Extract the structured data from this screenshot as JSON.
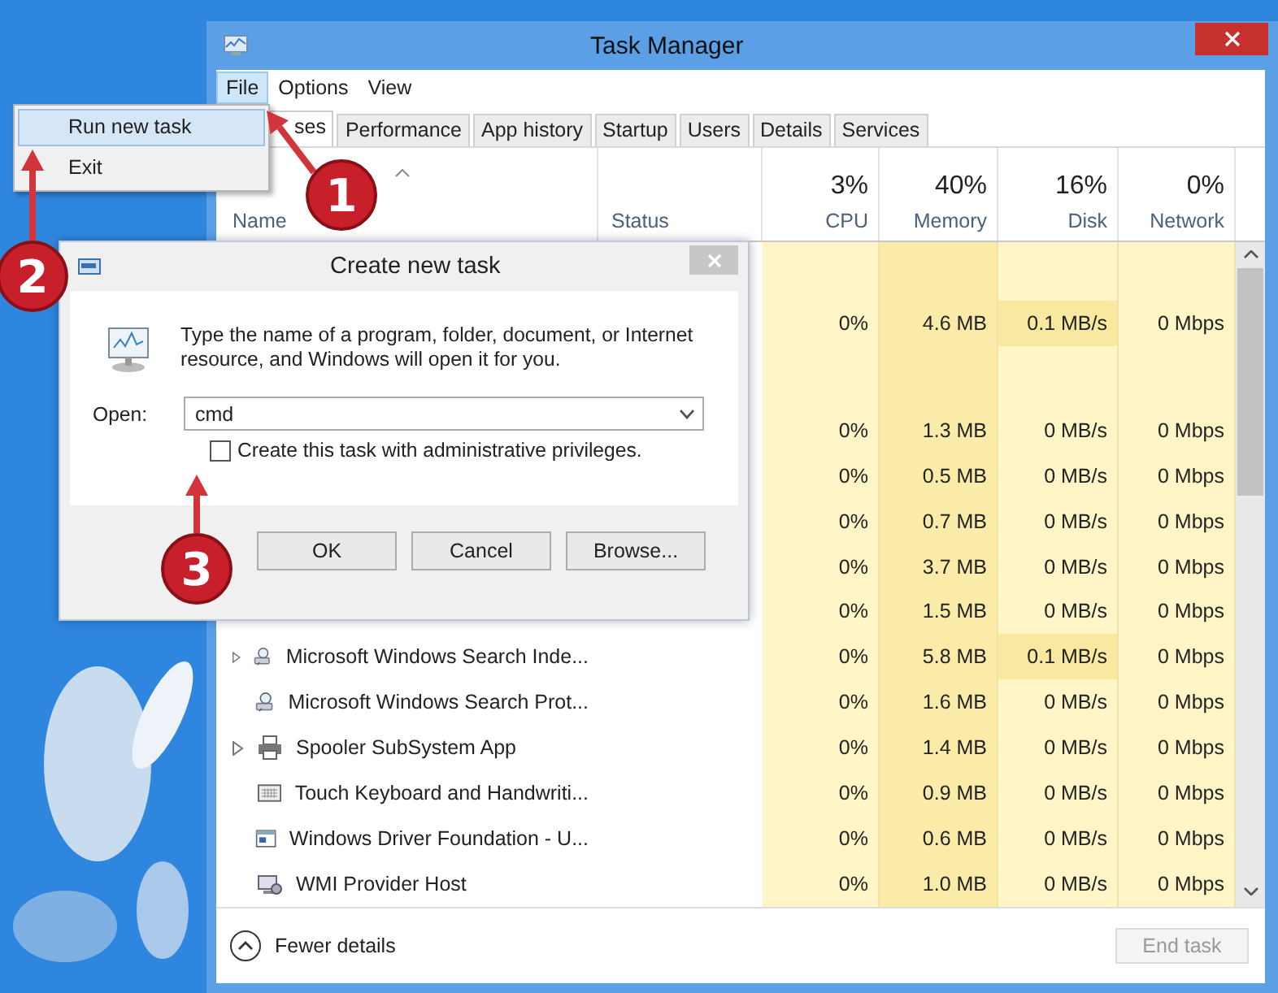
{
  "task_manager": {
    "title": "Task Manager",
    "menu": [
      {
        "label": "File",
        "selected": true
      },
      {
        "label": "Options",
        "selected": false
      },
      {
        "label": "View",
        "selected": false
      }
    ],
    "tabs": [
      {
        "label": "ses",
        "selected": true
      },
      {
        "label": "Performance",
        "selected": false
      },
      {
        "label": "App history",
        "selected": false
      },
      {
        "label": "Startup",
        "selected": false
      },
      {
        "label": "Users",
        "selected": false
      },
      {
        "label": "Details",
        "selected": false
      },
      {
        "label": "Services",
        "selected": false
      }
    ],
    "columns": [
      {
        "label": "Name"
      },
      {
        "label": "Status"
      },
      {
        "usage": "3%",
        "label": "CPU",
        "highlighted": false
      },
      {
        "usage": "40%",
        "label": "Memory",
        "highlighted": true
      },
      {
        "usage": "16%",
        "label": "Disk",
        "highlighted": false
      },
      {
        "usage": "0%",
        "label": "Network",
        "highlighted": false
      }
    ],
    "rows": [
      {
        "kind": "group"
      },
      {
        "kind": "hidden",
        "cells": [
          "0%",
          "4.6 MB",
          "0.1 MB/s",
          "0 Mbps"
        ],
        "disk_active": true
      },
      {
        "kind": "group"
      },
      {
        "kind": "hidden",
        "cells": [
          "0%",
          "1.3 MB",
          "0 MB/s",
          "0 Mbps"
        ],
        "disk_active": false
      },
      {
        "kind": "hidden",
        "cells": [
          "0%",
          "0.5 MB",
          "0 MB/s",
          "0 Mbps"
        ],
        "disk_active": false
      },
      {
        "kind": "hidden",
        "cells": [
          "0%",
          "0.7 MB",
          "0 MB/s",
          "0 Mbps"
        ],
        "disk_active": false
      },
      {
        "kind": "hidden",
        "cells": [
          "0%",
          "3.7 MB",
          "0 MB/s",
          "0 Mbps"
        ],
        "disk_active": false
      },
      {
        "kind": "hidden",
        "cells": [
          "0%",
          "1.5 MB",
          "0 MB/s",
          "0 Mbps"
        ],
        "disk_active": false
      },
      {
        "kind": "search",
        "name": "Microsoft Windows Search Inde...",
        "expandable": true,
        "cells": [
          "0%",
          "5.8 MB",
          "0.1 MB/s",
          "0 Mbps"
        ],
        "disk_active": true
      },
      {
        "kind": "search",
        "name": "Microsoft Windows Search Prot...",
        "expandable": false,
        "cells": [
          "0%",
          "1.6 MB",
          "0 MB/s",
          "0 Mbps"
        ],
        "disk_active": false
      },
      {
        "kind": "printer",
        "name": "Spooler SubSystem App",
        "expandable": true,
        "cells": [
          "0%",
          "1.4 MB",
          "0 MB/s",
          "0 Mbps"
        ],
        "disk_active": false
      },
      {
        "kind": "keyboard",
        "name": "Touch Keyboard and Handwriti...",
        "expandable": false,
        "cells": [
          "0%",
          "0.9 MB",
          "0 MB/s",
          "0 Mbps"
        ],
        "disk_active": false
      },
      {
        "kind": "driver",
        "name": "Windows Driver Foundation - U...",
        "expandable": false,
        "cells": [
          "0%",
          "0.6 MB",
          "0 MB/s",
          "0 Mbps"
        ],
        "disk_active": false
      },
      {
        "kind": "wmi",
        "name": "WMI Provider Host",
        "expandable": false,
        "cells": [
          "0%",
          "1.0 MB",
          "0 MB/s",
          "0 Mbps"
        ],
        "disk_active": false
      }
    ],
    "footer": {
      "details_link": "Fewer details",
      "end_task": {
        "label": "End task",
        "disabled": true
      }
    }
  },
  "file_menu": [
    {
      "label": "Run new task",
      "selected": true
    },
    {
      "label": "Exit",
      "selected": false
    }
  ],
  "dialog": {
    "title": "Create new task",
    "message": "Type the name of a program, folder, document, or Internet resource, and Windows will open it for you.",
    "open_label": "Open:",
    "open_value": "cmd",
    "checkbox": {
      "label": "Create this task with administrative privileges.",
      "checked": false
    },
    "buttons": [
      "OK",
      "Cancel",
      "Browse..."
    ]
  },
  "callouts": [
    {
      "number": "1"
    },
    {
      "number": "2"
    },
    {
      "number": "3"
    }
  ]
}
